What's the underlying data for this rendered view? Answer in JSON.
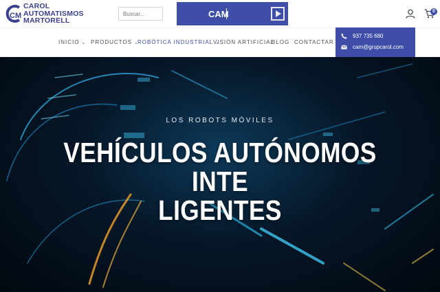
{
  "brand": {
    "logo_lines": [
      "CAROL",
      "AUTOMATISMOS",
      "MARTORELL"
    ],
    "monogram": "CM",
    "color": "#3a3f8f"
  },
  "search": {
    "placeholder": "Buscar..."
  },
  "cam_bar": {
    "text": "CAM"
  },
  "header_icons": {
    "user": "user-icon",
    "cart": "cart-icon",
    "cart_count": "0"
  },
  "nav": {
    "items": [
      {
        "label": "INICIO",
        "has_dropdown": true,
        "active": false
      },
      {
        "label": "PRODUCTOS",
        "has_dropdown": true,
        "active": false
      },
      {
        "label": "ROBÓTICA INDUSTRIAL",
        "has_dropdown": true,
        "active": true
      },
      {
        "label": "VISIÓN ARTIFICIAL",
        "has_dropdown": false,
        "active": false
      },
      {
        "label": "BLOG",
        "has_dropdown": false,
        "active": false
      },
      {
        "label": "CONTACTAR",
        "has_dropdown": false,
        "active": false
      }
    ]
  },
  "contact": {
    "phone": "937 735 680",
    "email": "cam@grupcarol.com"
  },
  "hero": {
    "subtitle": "LOS ROBOTS MÓVILES",
    "title_line1": "VEHÍCULOS AUTÓNOMOS INTE",
    "title_line2": "LIGENTES"
  },
  "colors": {
    "accent": "#3e4ea8",
    "active_nav": "#3e4ea8",
    "nav_text": "#4a4f5c"
  }
}
